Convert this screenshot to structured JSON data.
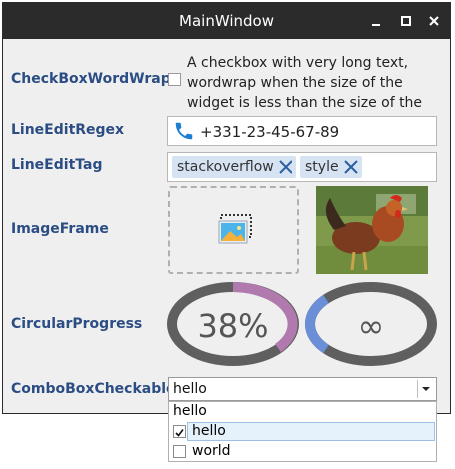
{
  "window": {
    "title": "MainWindow"
  },
  "labels": {
    "checkbox_wordwrap": "CheckBoxWordWrap",
    "lineedit_regex": "LineEditRegex",
    "lineedit_tag": "LineEditTag",
    "image_frame": "ImageFrame",
    "circular_progress": "CircularProgress",
    "combobox_checkable": "ComboBoxCheckable"
  },
  "checkbox": {
    "text_lines": [
      "A checkbox with very long text,",
      "wordwrap when the size of the",
      "widget is less than the size of the text."
    ],
    "checked": false
  },
  "regex_edit": {
    "value": "+331-23-45-67-89",
    "icon": "phone-icon"
  },
  "tags": [
    {
      "label": "stackoverflow"
    },
    {
      "label": "style"
    }
  ],
  "circular": [
    {
      "text": "38%",
      "progress": 0.38,
      "color": "#b07aae"
    },
    {
      "text": "∞",
      "color": "#6a8fd6"
    }
  ],
  "combo": {
    "value": "hello",
    "options": [
      {
        "label": "hello",
        "checkable": false
      },
      {
        "label": "hello",
        "checked": true,
        "selected": true
      },
      {
        "label": "world",
        "checked": false
      }
    ]
  },
  "colors": {
    "label": "#2b4d83",
    "titlebar": "#2b2b2b",
    "ring": "#5f5f5f"
  }
}
